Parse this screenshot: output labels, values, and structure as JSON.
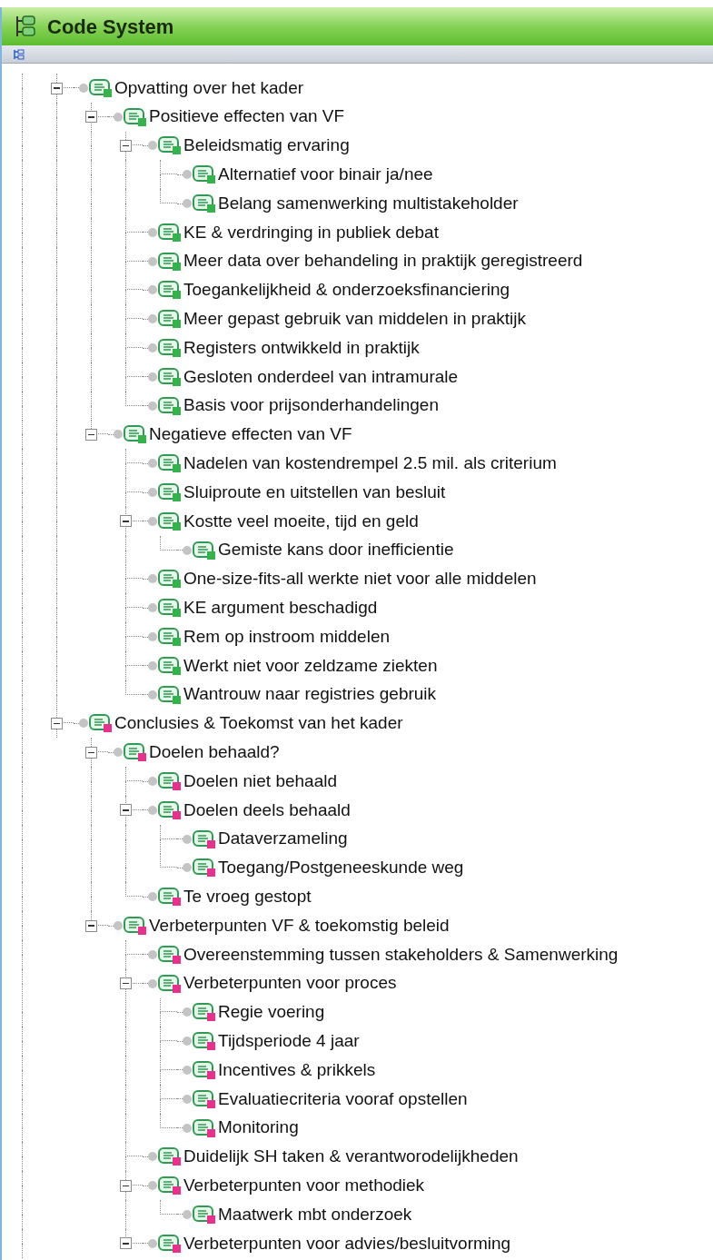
{
  "panel": {
    "title": "Code System"
  },
  "tree": [
    {
      "label": "Opvatting over het kader",
      "color": "#33b34a",
      "expanded": true,
      "children": [
        {
          "label": "Positieve effecten van VF",
          "color": "#33b34a",
          "expanded": true,
          "children": [
            {
              "label": "Beleidsmatig ervaring",
              "color": "#33b34a",
              "expanded": true,
              "children": [
                {
                  "label": "Alternatief voor binair ja/nee",
                  "color": "#33b34a"
                },
                {
                  "label": "Belang samenwerking multistakeholder",
                  "color": "#33b34a"
                }
              ]
            },
            {
              "label": "KE & verdringing in publiek debat",
              "color": "#33b34a"
            },
            {
              "label": "Meer data over behandeling in praktijk geregistreerd",
              "color": "#33b34a"
            },
            {
              "label": "Toegankelijkheid & onderzoeksfinanciering",
              "color": "#33b34a"
            },
            {
              "label": "Meer gepast gebruik van middelen in praktijk",
              "color": "#33b34a"
            },
            {
              "label": "Registers ontwikkeld in praktijk",
              "color": "#33b34a"
            },
            {
              "label": "Gesloten onderdeel van intramurale",
              "color": "#33b34a"
            },
            {
              "label": "Basis voor prijsonderhandelingen",
              "color": "#33b34a"
            }
          ]
        },
        {
          "label": "Negatieve effecten van VF",
          "color": "#33b34a",
          "expanded": true,
          "children": [
            {
              "label": "Nadelen van kostendrempel 2.5 mil. als criterium",
              "color": "#33b34a"
            },
            {
              "label": "Sluiproute en uitstellen van besluit",
              "color": "#33b34a"
            },
            {
              "label": "Kostte veel moeite, tijd en geld",
              "color": "#33b34a",
              "expanded": true,
              "children": [
                {
                  "label": "Gemiste kans door inefficientie",
                  "color": "#33b34a"
                }
              ]
            },
            {
              "label": "One-size-fits-all werkte niet voor alle middelen",
              "color": "#33b34a"
            },
            {
              "label": "KE argument beschadigd",
              "color": "#33b34a"
            },
            {
              "label": "Rem op instroom middelen",
              "color": "#33b34a"
            },
            {
              "label": "Werkt niet voor zeldzame ziekten",
              "color": "#33b34a"
            },
            {
              "label": "Wantrouw naar registries gebruik",
              "color": "#33b34a"
            }
          ]
        }
      ]
    },
    {
      "label": "Conclusies & Toekomst van het kader",
      "color": "#e8308c",
      "expanded": true,
      "children": [
        {
          "label": "Doelen behaald?",
          "color": "#e8308c",
          "expanded": true,
          "children": [
            {
              "label": "Doelen niet behaald",
              "color": "#e8308c"
            },
            {
              "label": "Doelen deels behaald",
              "color": "#e8308c",
              "expanded": true,
              "children": [
                {
                  "label": "Dataverzameling",
                  "color": "#e8308c"
                },
                {
                  "label": "Toegang/Postgeneeskunde weg",
                  "color": "#e8308c"
                }
              ]
            },
            {
              "label": "Te vroeg gestopt",
              "color": "#e8308c"
            }
          ]
        },
        {
          "label": "Verbeterpunten VF & toekomstig beleid",
          "color": "#e8308c",
          "expanded": true,
          "children": [
            {
              "label": "Overeenstemming tussen stakeholders & Samenwerking",
              "color": "#e8308c"
            },
            {
              "label": "Verbeterpunten voor proces",
              "color": "#e8308c",
              "expanded": true,
              "children": [
                {
                  "label": "Regie voering",
                  "color": "#e8308c"
                },
                {
                  "label": "Tijdsperiode 4 jaar",
                  "color": "#e8308c"
                },
                {
                  "label": "Incentives & prikkels",
                  "color": "#e8308c"
                },
                {
                  "label": "Evaluatiecriteria vooraf opstellen",
                  "color": "#e8308c"
                },
                {
                  "label": "Monitoring",
                  "color": "#e8308c"
                }
              ]
            },
            {
              "label": "Duidelijk SH taken & verantworodelijkheden",
              "color": "#e8308c"
            },
            {
              "label": "Verbeterpunten voor methodiek",
              "color": "#e8308c",
              "expanded": true,
              "children": [
                {
                  "label": "Maatwerk mbt onderzoek",
                  "color": "#e8308c"
                }
              ]
            },
            {
              "label": "Verbeterpunten voor advies/besluitvorming",
              "color": "#e8308c",
              "expanded": true
            }
          ]
        }
      ]
    }
  ]
}
